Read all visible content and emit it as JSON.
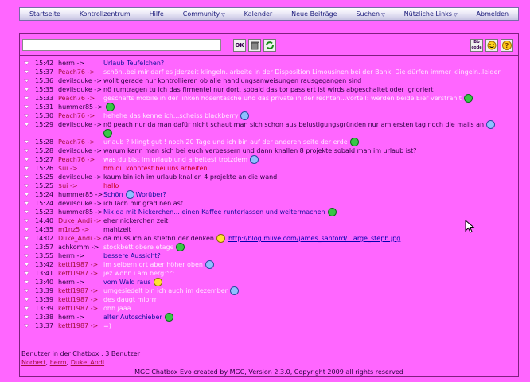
{
  "nav": [
    {
      "label": "Startseite",
      "dropdown": false
    },
    {
      "label": "Kontrollzentrum",
      "dropdown": false
    },
    {
      "label": "Hilfe",
      "dropdown": false
    },
    {
      "label": "Community",
      "dropdown": true
    },
    {
      "label": "Kalender",
      "dropdown": false
    },
    {
      "label": "Neue Beiträge",
      "dropdown": false
    },
    {
      "label": "Suchen",
      "dropdown": true
    },
    {
      "label": "Nützliche Links",
      "dropdown": true
    },
    {
      "label": "Abmelden",
      "dropdown": false
    }
  ],
  "input": {
    "value": "",
    "ok_label": "OK"
  },
  "toolbar": {
    "bbcode_label": "Bb code"
  },
  "messages": [
    {
      "time": "15:42",
      "user": "herm ->",
      "ucolor": "dark",
      "text": "Urlaub Teufelchen?",
      "tcolor": "blue"
    },
    {
      "time": "15:37",
      "user": "Peach76 ->",
      "ucolor": "red",
      "text": "schön..bei mir darf es jderzeit klingeln. arbeite in der Disposition Limousinen bei der Bank. Die dürfen immer klingeln..leider",
      "tcolor": "light"
    },
    {
      "time": "15:36",
      "user": "devilsduke ->",
      "ucolor": "dark",
      "text": "wollt gerade nur kontrollieren ob alle handlungsanweisungen rausgegangen sind",
      "tcolor": "dark"
    },
    {
      "time": "15:35",
      "user": "devilsduke ->",
      "ucolor": "dark",
      "text": "nö rumtragen tu ich das firmentel nur dort, sobald das tor passiert ist wirds abgeschaltet oder ignoriert",
      "tcolor": "dark"
    },
    {
      "time": "15:33",
      "user": "Peach76 ->",
      "ucolor": "red",
      "text": "geschäfts mobile in der linken hosentasche und das private in der rechten...vorteil: werden beide Eier verstrahlt",
      "tcolor": "light",
      "smiley": "green"
    },
    {
      "time": "15:31",
      "user": "hummer85 ->",
      "ucolor": "dark",
      "text": "",
      "tcolor": "dark",
      "smiley": "green"
    },
    {
      "time": "15:30",
      "user": "Peach76 ->",
      "ucolor": "red",
      "text": "hehehe das kenne ich...scheiss blackberry",
      "tcolor": "light",
      "smiley": "blue"
    },
    {
      "time": "15:29",
      "user": "devilsduke ->",
      "ucolor": "dark",
      "text": "nö peach nur da man dafür nicht schaut man sich schon aus belustigungsgründen nur am ersten tag noch die mails an",
      "tcolor": "dark",
      "smiley": "blue",
      "tall": true,
      "smiley2": "green"
    },
    {
      "time": "15:28",
      "user": "Peach76 ->",
      "ucolor": "red",
      "text": "urlaub ? klingt gut ! noch 20 Tage und ich bin auf der anderen seite der erde",
      "tcolor": "light",
      "smiley": "green"
    },
    {
      "time": "15:28",
      "user": "devilsduke ->",
      "ucolor": "dark",
      "text": "warum kann man sich bei euch verbessern und dann knallen 8 projekte sobald man im urlaub ist?",
      "tcolor": "dark"
    },
    {
      "time": "15:27",
      "user": "Peach76 ->",
      "ucolor": "red",
      "text": "was du bist im urlaub und arbeitest trotzdem",
      "tcolor": "light",
      "smiley": "blue"
    },
    {
      "time": "15:26",
      "user": "$ui ->",
      "ucolor": "red",
      "text": "hm du könntest bei uns arbeiten",
      "tcolor": "red"
    },
    {
      "time": "15:25",
      "user": "devilsduke ->",
      "ucolor": "dark",
      "text": "kaum bin ich im urlaub knallen 4 projekte an die wand",
      "tcolor": "dark"
    },
    {
      "time": "15:25",
      "user": "$ui ->",
      "ucolor": "red",
      "text": "hallo",
      "tcolor": "red"
    },
    {
      "time": "15:24",
      "user": "hummer85 ->",
      "ucolor": "dark",
      "text": "Schön",
      "tcolor": "blue",
      "smiley": "blue",
      "after": "Worüber?"
    },
    {
      "time": "15:24",
      "user": "devilsduke ->",
      "ucolor": "dark",
      "text": "ich lach mir grad nen ast",
      "tcolor": "dark"
    },
    {
      "time": "15:23",
      "user": "hummer85 ->",
      "ucolor": "dark",
      "text": "Nix da mit Nickerchen... einen Kaffee runterlassen und weitermachen",
      "tcolor": "blue",
      "smiley": "green"
    },
    {
      "time": "14:40",
      "user": "Duke_Andi ->",
      "ucolor": "red",
      "text": "eher nickerchen zeit",
      "tcolor": "dark"
    },
    {
      "time": "14:35",
      "user": "m1nz5 ->",
      "ucolor": "red",
      "text": "mahlzeit",
      "tcolor": "dark"
    },
    {
      "time": "14:02",
      "user": "Duke_Andi ->",
      "ucolor": "red",
      "text": "da muss ich an stiefbrüder denken",
      "tcolor": "dark",
      "smiley": "yellow",
      "link": "http://blog.mlive.com/james_sanford/...arge_stepb.jpg"
    },
    {
      "time": "13:57",
      "user": "achkomm ->",
      "ucolor": "dark",
      "text": "stockbett obere etage",
      "tcolor": "light",
      "smiley": "green"
    },
    {
      "time": "13:55",
      "user": "herm ->",
      "ucolor": "dark",
      "text": "bessere Aussicht?",
      "tcolor": "blue"
    },
    {
      "time": "13:42",
      "user": "kettl1987 ->",
      "ucolor": "red",
      "text": "im selbern ort aber höher oben",
      "tcolor": "light",
      "smiley": "blue"
    },
    {
      "time": "13:41",
      "user": "kettl1987 ->",
      "ucolor": "red",
      "text": "jez wohn i am berg^^",
      "tcolor": "light"
    },
    {
      "time": "13:40",
      "user": "herm ->",
      "ucolor": "dark",
      "text": "vom Wald raus",
      "tcolor": "blue",
      "smiley": "yellow"
    },
    {
      "time": "13:39",
      "user": "kettl1987 ->",
      "ucolor": "red",
      "text": "umgesiedelt bin ich auch im dezember",
      "tcolor": "light",
      "smiley": "blue"
    },
    {
      "time": "13:39",
      "user": "kettl1987 ->",
      "ucolor": "red",
      "text": "des daugt miorrr",
      "tcolor": "light"
    },
    {
      "time": "13:39",
      "user": "kettl1987 ->",
      "ucolor": "red",
      "text": "ohh jaaa",
      "tcolor": "light"
    },
    {
      "time": "13:38",
      "user": "herm ->",
      "ucolor": "dark",
      "text": "alter Autoschieber",
      "tcolor": "blue",
      "smiley": "green"
    },
    {
      "time": "13:37",
      "user": "kettl1987 ->",
      "ucolor": "red",
      "text": "=)",
      "tcolor": "light"
    }
  ],
  "users": {
    "title": "Benutzer in der Chatbox : 3 Benutzer",
    "names": [
      "Norbert",
      "herm",
      "Duke_Andi"
    ]
  },
  "footer": "MGC Chatbox Evo created by MGC, Version 2.3.0, Copyright 2009 all rights reserved"
}
